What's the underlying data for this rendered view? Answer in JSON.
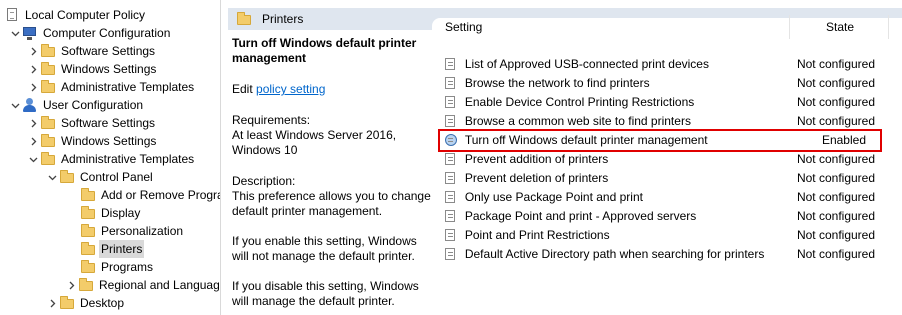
{
  "tree": {
    "items": [
      {
        "label": "Local Computer Policy",
        "icon": "doc-icon"
      },
      {
        "label": "Computer Configuration",
        "icon": "computer-icon"
      },
      {
        "label": "Software Settings",
        "icon": "folder-icon"
      },
      {
        "label": "Windows Settings",
        "icon": "folder-icon"
      },
      {
        "label": "Administrative Templates",
        "icon": "folder-icon"
      },
      {
        "label": "User Configuration",
        "icon": "user-icon"
      },
      {
        "label": "Software Settings",
        "icon": "folder-icon"
      },
      {
        "label": "Windows Settings",
        "icon": "folder-icon"
      },
      {
        "label": "Administrative Templates",
        "icon": "folder-icon"
      },
      {
        "label": "Control Panel",
        "icon": "folder-icon"
      },
      {
        "label": "Add or Remove Programs",
        "icon": "folder-icon"
      },
      {
        "label": "Display",
        "icon": "folder-icon"
      },
      {
        "label": "Personalization",
        "icon": "folder-icon"
      },
      {
        "label": "Printers",
        "icon": "folder-icon"
      },
      {
        "label": "Programs",
        "icon": "folder-icon"
      },
      {
        "label": "Regional and Language Options",
        "icon": "folder-icon"
      },
      {
        "label": "Desktop",
        "icon": "folder-icon"
      }
    ]
  },
  "header": {
    "title": "Printers"
  },
  "description": {
    "title": "Turn off Windows default printer management",
    "edit_prefix": "Edit ",
    "edit_link": "policy setting",
    "requirements_label": "Requirements:",
    "requirements_text": "At least Windows Server 2016, Windows 10",
    "description_label": "Description:",
    "description_text": "This preference allows you to change default printer management.",
    "enable_text": "If you enable this setting, Windows will not manage the default printer.",
    "disable_text": "If you disable this setting, Windows will manage the default printer."
  },
  "columns": {
    "setting": "Setting",
    "state": "State"
  },
  "policies": [
    {
      "setting": "List of Approved USB-connected print devices",
      "state": "Not configured"
    },
    {
      "setting": "Browse the network to find printers",
      "state": "Not configured"
    },
    {
      "setting": "Enable Device Control Printing Restrictions",
      "state": "Not configured"
    },
    {
      "setting": "Browse a common web site to find printers",
      "state": "Not configured"
    },
    {
      "setting": "Turn off Windows default printer management",
      "state": "Enabled"
    },
    {
      "setting": "Prevent addition of printers",
      "state": "Not configured"
    },
    {
      "setting": "Prevent deletion of printers",
      "state": "Not configured"
    },
    {
      "setting": "Only use Package Point and print",
      "state": "Not configured"
    },
    {
      "setting": "Package Point and print - Approved servers",
      "state": "Not configured"
    },
    {
      "setting": "Point and Print Restrictions",
      "state": "Not configured"
    },
    {
      "setting": "Default Active Directory path when searching for printers",
      "state": "Not configured"
    }
  ],
  "colors": {
    "highlight_border": "#e00000",
    "header_bg": "#dfe6ef",
    "link": "#0066cc"
  }
}
